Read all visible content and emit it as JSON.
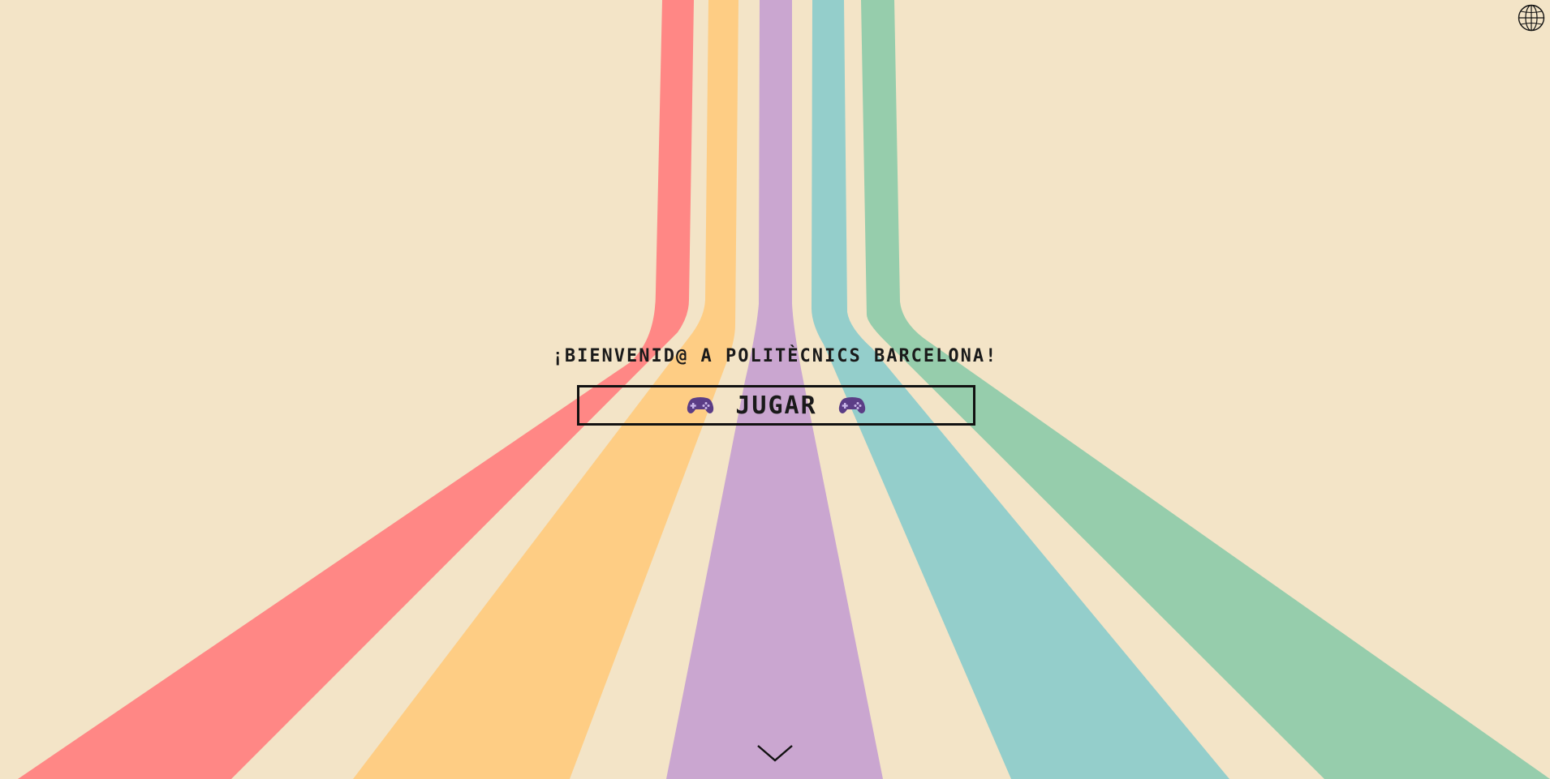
{
  "page": {
    "background_color": "#f3e4c7"
  },
  "hero": {
    "welcome_text": "¡BIENVENID@ A POLITÈCNICS BARCELONA!",
    "play_label": "JUGAR",
    "play_icon": "gamepad-icon"
  },
  "stripes": {
    "colors": [
      "#ff8785",
      "#fecd84",
      "#caa6d0",
      "#94cecb",
      "#96cdac"
    ],
    "names": [
      "red-stripe",
      "orange-stripe",
      "purple-stripe",
      "teal-stripe",
      "green-stripe"
    ]
  },
  "icons": {
    "language": "globe-icon",
    "scroll": "chevron-down-icon"
  },
  "colors": {
    "text": "#1a1a1a",
    "gamepad": "#5b3d86",
    "gamepad_buttons": "#c9b6e8"
  }
}
